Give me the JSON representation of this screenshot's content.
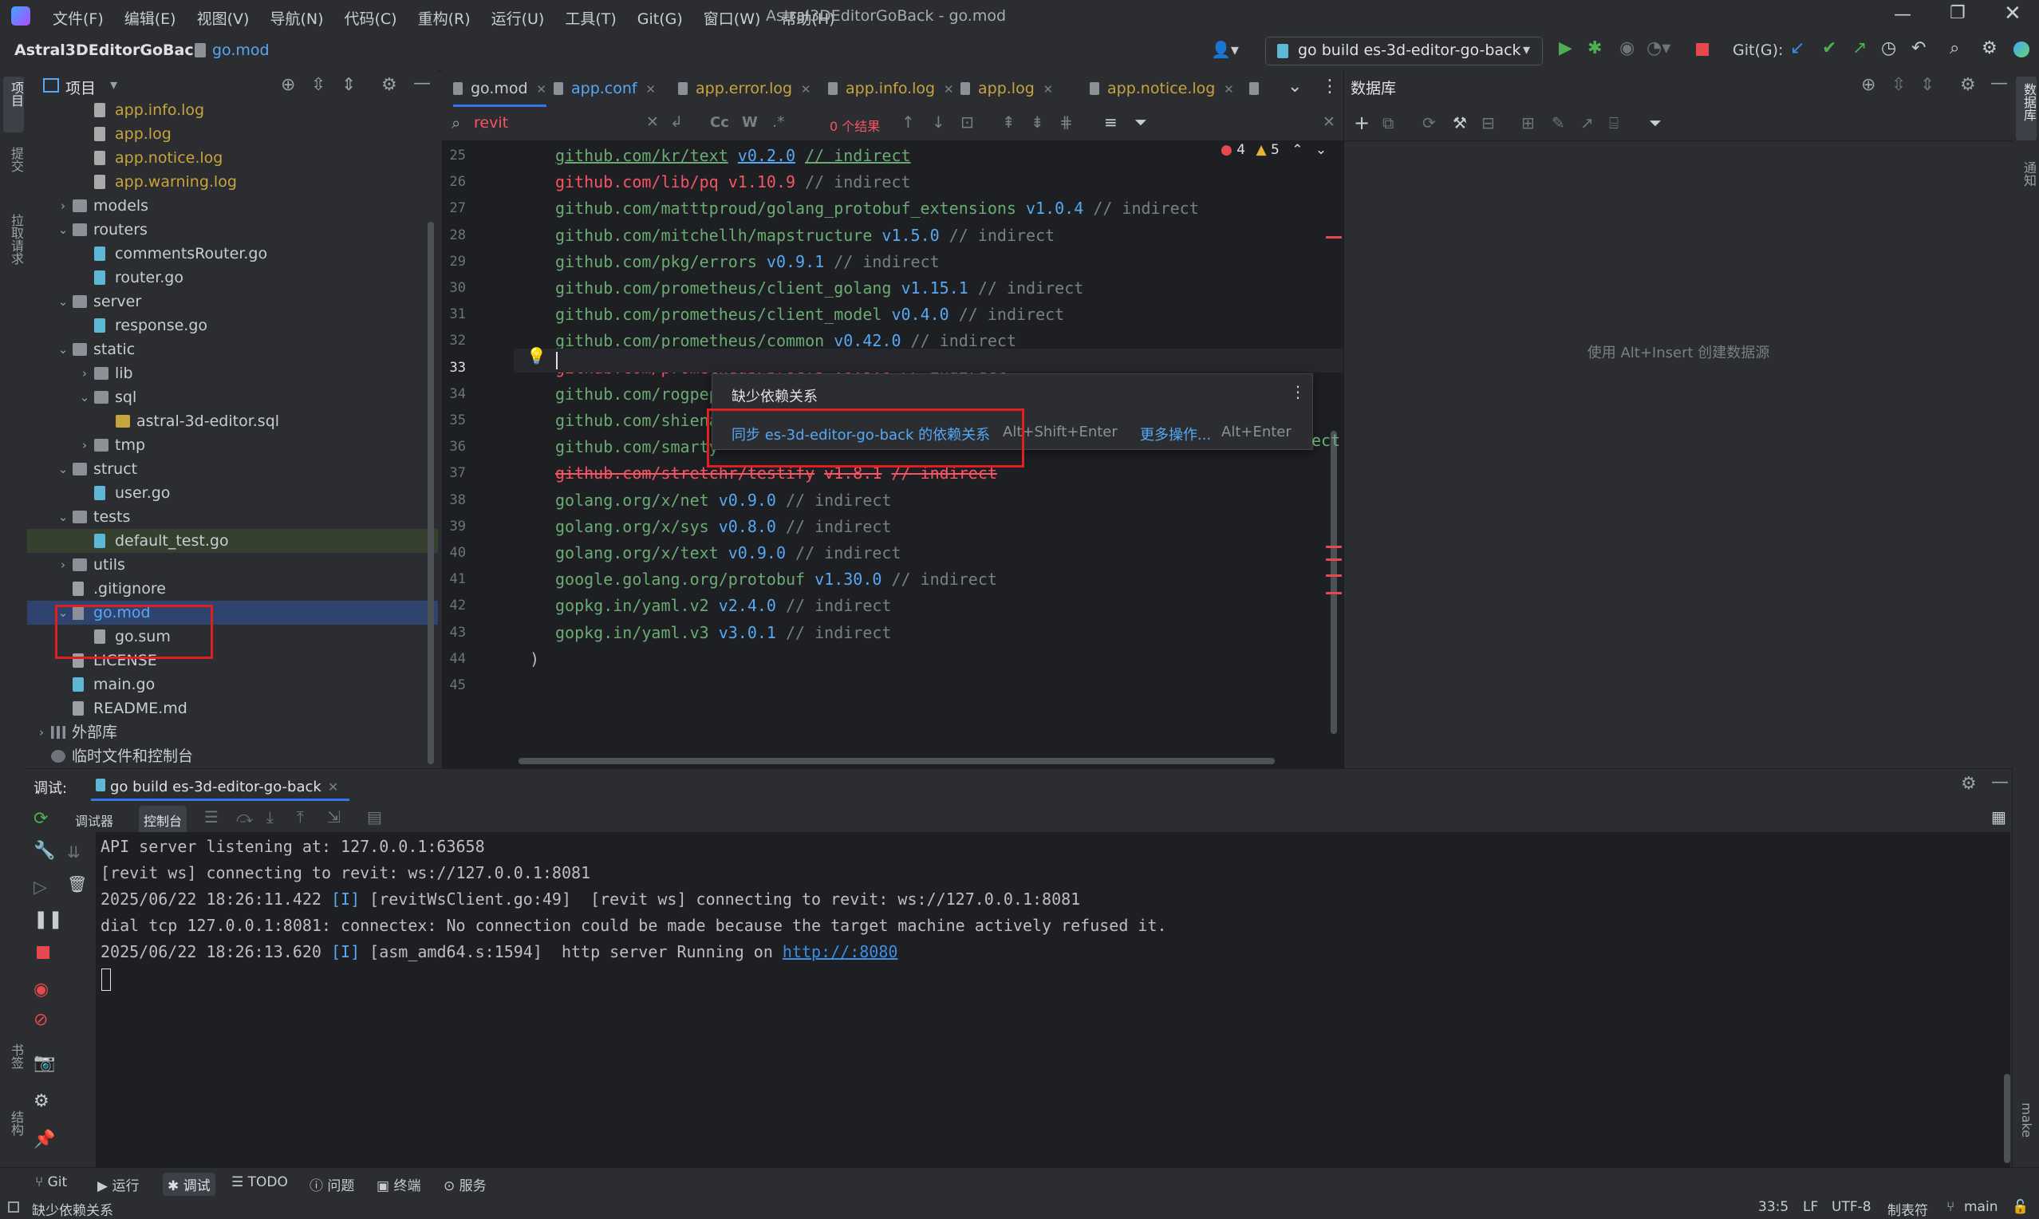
{
  "titlebar": {
    "menu": [
      "文件(F)",
      "编辑(E)",
      "视图(V)",
      "导航(N)",
      "代码(C)",
      "重构(R)",
      "运行(U)",
      "工具(T)",
      "Git(G)",
      "窗口(W)",
      "帮助(H)"
    ],
    "title": "Astral3DEditorGoBack - go.mod"
  },
  "navbar": {
    "project": "Astral3DEditorGoBack",
    "file": "go.mod",
    "run_config": "go build es-3d-editor-go-back",
    "git_label": "Git(G):"
  },
  "leftstrip": {
    "project": "项目",
    "commit": "提交",
    "pull": "拉取请求",
    "bookmarks": "书签",
    "structure": "结构"
  },
  "rightstrip": {
    "database": "数据库",
    "notifications": "通知",
    "make": "make"
  },
  "project_panel": {
    "title": "项目",
    "items": [
      {
        "label": "app.info.log",
        "type": "log"
      },
      {
        "label": "app.log",
        "type": "log"
      },
      {
        "label": "app.notice.log",
        "type": "log"
      },
      {
        "label": "app.warning.log",
        "type": "log"
      },
      {
        "label": "models",
        "type": "folder",
        "chev": "›"
      },
      {
        "label": "routers",
        "type": "folder",
        "chev": "⌄"
      },
      {
        "label": "commentsRouter.go",
        "type": "go"
      },
      {
        "label": "router.go",
        "type": "go"
      },
      {
        "label": "server",
        "type": "folder",
        "chev": "⌄"
      },
      {
        "label": "response.go",
        "type": "go"
      },
      {
        "label": "static",
        "type": "folder",
        "chev": "⌄"
      },
      {
        "label": "lib",
        "type": "folder",
        "chev": "›"
      },
      {
        "label": "sql",
        "type": "folder",
        "chev": "⌄"
      },
      {
        "label": "astral-3d-editor.sql",
        "type": "sql"
      },
      {
        "label": "tmp",
        "type": "folder",
        "chev": "›"
      },
      {
        "label": "struct",
        "type": "folder",
        "chev": "⌄"
      },
      {
        "label": "user.go",
        "type": "go"
      },
      {
        "label": "tests",
        "type": "folder",
        "chev": "⌄"
      },
      {
        "label": "default_test.go",
        "type": "go"
      },
      {
        "label": "utils",
        "type": "folder",
        "chev": "›"
      },
      {
        "label": ".gitignore",
        "type": "file"
      },
      {
        "label": "go.mod",
        "type": "mod",
        "chev": "⌄"
      },
      {
        "label": "go.sum",
        "type": "file"
      },
      {
        "label": "LICENSE",
        "type": "file"
      },
      {
        "label": "main.go",
        "type": "go"
      },
      {
        "label": "README.md",
        "type": "file"
      },
      {
        "label": "外部库",
        "type": "lib",
        "chev": "›"
      },
      {
        "label": "临时文件和控制台",
        "type": "scratch"
      }
    ]
  },
  "editor": {
    "tabs": [
      "go.mod",
      "app.conf",
      "app.error.log",
      "app.info.log",
      "app.log",
      "app.notice.log"
    ],
    "search_text": "revit",
    "search_result": "0 个结果",
    "error_count": "4",
    "warning_count": "5",
    "lines": [
      {
        "n": "25",
        "mod": "github.com/kr/text",
        "ver": "v0.2.0",
        "cmt": "// indirect",
        "kind": "str"
      },
      {
        "n": "26",
        "mod": "github.com/lib/pq",
        "ver": "v1.10.9",
        "cmt": "// indirect",
        "kind": "red"
      },
      {
        "n": "27",
        "mod": "github.com/matttproud/golang_protobuf_extensions",
        "ver": "v1.0.4",
        "cmt": "// indirect",
        "kind": "str"
      },
      {
        "n": "28",
        "mod": "github.com/mitchellh/mapstructure",
        "ver": "v1.5.0",
        "cmt": "// indirect",
        "kind": "str"
      },
      {
        "n": "29",
        "mod": "github.com/pkg/errors",
        "ver": "v0.9.1",
        "cmt": "// indirect",
        "kind": "str"
      },
      {
        "n": "30",
        "mod": "github.com/prometheus/client_golang",
        "ver": "v1.15.1",
        "cmt": "// indirect",
        "kind": "str"
      },
      {
        "n": "31",
        "mod": "github.com/prometheus/client_model",
        "ver": "v0.4.0",
        "cmt": "// indirect",
        "kind": "str"
      },
      {
        "n": "32",
        "mod": "github.com/prometheus/common",
        "ver": "v0.42.0",
        "cmt": "// indirect",
        "kind": "str"
      },
      {
        "n": "33",
        "mod": "github.com/prometheus/procfs",
        "ver": "v0.9.0",
        "cmt": "// indirect",
        "kind": "red"
      },
      {
        "n": "34",
        "mod": "github.com/rogpep",
        "ver": "",
        "cmt": "",
        "kind": "str"
      },
      {
        "n": "35",
        "mod": "github.com/shiena",
        "ver": "",
        "cmt": "",
        "kind": "str"
      },
      {
        "n": "36",
        "mod": "github.com/smarty",
        "ver": "",
        "cmt": "",
        "kind": "str"
      },
      {
        "n": "37",
        "mod": "github.com/stretchr/testify",
        "ver": "v1.8.1",
        "cmt": "// indirect",
        "kind": "red"
      },
      {
        "n": "38",
        "mod": "golang.org/x/net",
        "ver": "v0.9.0",
        "cmt": "// indirect",
        "kind": "str"
      },
      {
        "n": "39",
        "mod": "golang.org/x/sys",
        "ver": "v0.8.0",
        "cmt": "// indirect",
        "kind": "str"
      },
      {
        "n": "40",
        "mod": "golang.org/x/text",
        "ver": "v0.9.0",
        "cmt": "// indirect",
        "kind": "str"
      },
      {
        "n": "41",
        "mod": "google.golang.org/protobuf",
        "ver": "v1.30.0",
        "cmt": "// indirect",
        "kind": "str"
      },
      {
        "n": "42",
        "mod": "gopkg.in/yaml.v2",
        "ver": "v2.4.0",
        "cmt": "// indirect",
        "kind": "str"
      },
      {
        "n": "43",
        "mod": "gopkg.in/yaml.v3",
        "ver": "v3.0.1",
        "cmt": "// indirect",
        "kind": "str"
      },
      {
        "n": "44",
        "mod": ")",
        "ver": "",
        "cmt": "",
        "kind": "pun"
      },
      {
        "n": "45",
        "mod": "",
        "ver": "",
        "cmt": "",
        "kind": "pun"
      }
    ]
  },
  "popup": {
    "title": "缺少依赖关系",
    "action": "同步 es-3d-editor-go-back 的依赖关系",
    "action_shortcut": "Alt+Shift+Enter",
    "more": "更多操作...",
    "more_shortcut": "Alt+Enter",
    "tail": "ect"
  },
  "db_panel": {
    "title": "数据库",
    "hint": "使用 Alt+Insert 创建数据源"
  },
  "debug": {
    "label": "调试:",
    "config": "go build es-3d-editor-go-back",
    "tab_debugger": "调试器",
    "tab_console": "控制台",
    "console": [
      {
        "pre": "API server listening at: 127.0.0.1:63658",
        "tag": "",
        "post": "",
        "link": ""
      },
      {
        "pre": "[revit ws] connecting to revit: ws://127.0.0.1:8081",
        "tag": "",
        "post": "",
        "link": ""
      },
      {
        "pre": "2025/06/22 18:26:11.422 ",
        "tag": "[I]",
        "post": " [revitWsClient.go:49]  [revit ws] connecting to revit: ws://127.0.0.1:8081",
        "link": ""
      },
      {
        "pre": "dial tcp 127.0.0.1:8081: connectex: No connection could be made because the target machine actively refused it.",
        "tag": "",
        "post": "",
        "link": ""
      },
      {
        "pre": "2025/06/22 18:26:13.620 ",
        "tag": "[I]",
        "post": " [asm_amd64.s:1594]  http server Running on ",
        "link": "http://:8080"
      }
    ]
  },
  "toolstrip": [
    "Git",
    "运行",
    "调试",
    "TODO",
    "问题",
    "终端",
    "服务"
  ],
  "status": {
    "message": "缺少依赖关系",
    "position": "33:5",
    "line_sep": "LF",
    "encoding": "UTF-8",
    "indent": "制表符",
    "branch": "main"
  }
}
